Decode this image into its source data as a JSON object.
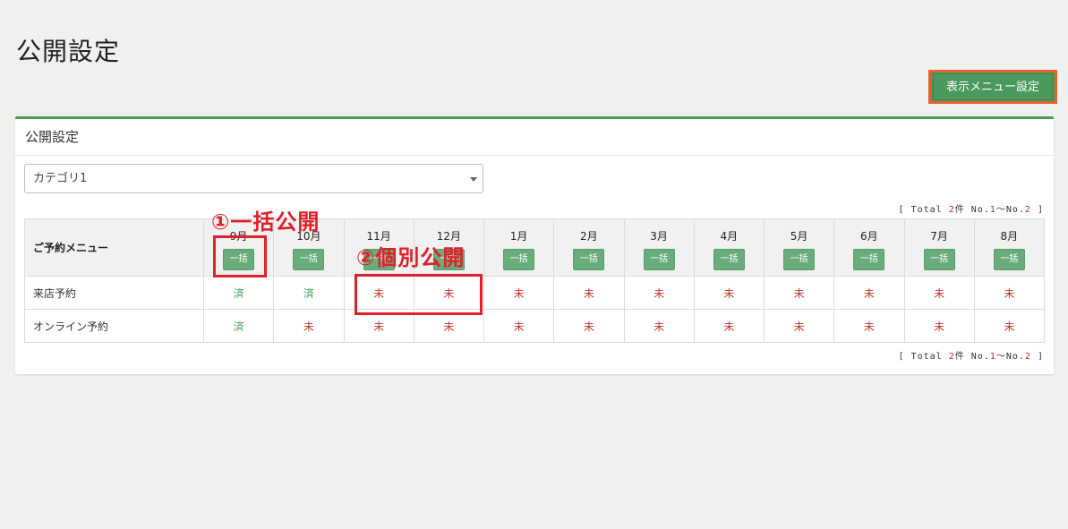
{
  "page": {
    "title": "公開設定",
    "menu_settings_button": "表示メニュー設定"
  },
  "panel": {
    "title": "公開設定",
    "category_select": "カテゴリ1",
    "total": {
      "prefix": "[ Total ",
      "count": "2",
      "mid": "件 No.",
      "from": "1",
      "sep": "～No.",
      "to": "2",
      "suffix": " ]"
    }
  },
  "table": {
    "menu_header": "ご予約メニュー",
    "bulk_label": "一括",
    "months": [
      "9月",
      "10月",
      "11月",
      "12月",
      "1月",
      "2月",
      "3月",
      "4月",
      "5月",
      "6月",
      "7月",
      "8月"
    ],
    "rows": [
      {
        "name": "来店予約",
        "cells": [
          "済",
          "済",
          "未",
          "未",
          "未",
          "未",
          "未",
          "未",
          "未",
          "未",
          "未",
          "未"
        ]
      },
      {
        "name": "オンライン予約",
        "cells": [
          "済",
          "未",
          "未",
          "未",
          "未",
          "未",
          "未",
          "未",
          "未",
          "未",
          "未",
          "未"
        ]
      }
    ]
  },
  "annotations": {
    "bulk": "①一括公開",
    "individual": "②個別公開",
    "color": "#e0202a"
  },
  "colors": {
    "accent": "#4a9a5e",
    "highlight": "#e8602a",
    "done": "#3aa34c",
    "not_done": "#c0392b"
  }
}
